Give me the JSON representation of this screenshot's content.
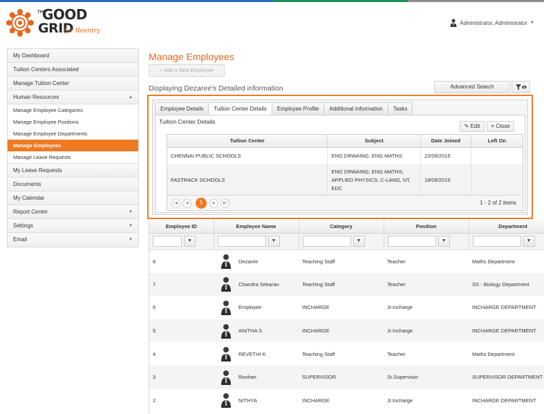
{
  "colors": {
    "accent": "#f07a22",
    "topbar": [
      "#2a6ebb",
      "#1f8f5a",
      "#7a7a7a"
    ]
  },
  "header": {
    "logo": {
      "the": "THE",
      "good": "GOOD",
      "grid": "GRID",
      "tagline": "for Reentry"
    },
    "user": {
      "name": "Administrator, Administrator",
      "icon": "user-avatar-icon"
    }
  },
  "sidebar": {
    "items": [
      {
        "label": "My Dashboard"
      },
      {
        "label": "Tuition Centers Associated"
      },
      {
        "label": "Manage Tuition Center"
      },
      {
        "label": "Human Resources",
        "expanded": true
      }
    ],
    "sub_items": [
      {
        "label": "Manage Employee Categories"
      },
      {
        "label": "Manage Employee Positions"
      },
      {
        "label": "Manage Employee Departments"
      },
      {
        "label": "Manage Employees",
        "active": true
      },
      {
        "label": "Manage Leave Requests"
      }
    ],
    "items_after": [
      {
        "label": "My Leave Requests"
      },
      {
        "label": "Documents"
      },
      {
        "label": "My Calendar"
      },
      {
        "label": "Report Center",
        "arrow": "▼"
      },
      {
        "label": "Settings",
        "arrow": "▼"
      },
      {
        "label": "Email",
        "arrow": "▼"
      }
    ]
  },
  "main": {
    "title": "Manage Employees",
    "add_button": "+ Add a New Employee",
    "subheading": "Displaying Dezaree's Detailed information",
    "advanced_search": "Advanced Search"
  },
  "detail": {
    "tabs": [
      "Employee Details",
      "Tuition Center Details",
      "Employee Profile",
      "Additional Information",
      "Tasks"
    ],
    "active_tab": 1,
    "section_title": "Tuition Center Details",
    "edit_label": "Edit",
    "close_label": "Close",
    "columns": [
      "Tuition Center",
      "Subject",
      "Date Joined",
      "Left On"
    ],
    "rows": [
      {
        "center": "CHENNAI PUBLIC SCHOOLS",
        "subject": "ENG DRWAING, ENG MATHS",
        "joined": "22/09/2015",
        "left": ""
      },
      {
        "center": "FASTRACK SCHOOLS",
        "subject": "ENG DRWAING, ENG MATHS, APPLIED PHYSICS, C-LANG, NT, EDC",
        "joined": "18/09/2015",
        "left": ""
      }
    ],
    "pager": {
      "current_page": "1",
      "info": "1 - 2 of 2 items"
    }
  },
  "grid": {
    "columns": [
      "Employee ID",
      "Employee Name",
      "Category",
      "Position",
      "Department"
    ],
    "rows": [
      {
        "id": "8",
        "name": "Dezaree",
        "category": "Teaching Staff",
        "position": "Teacher",
        "department": "Maths Department"
      },
      {
        "id": "7",
        "name": "Chandra Sekaran",
        "category": "Teaching Staff",
        "position": "Teacher",
        "department": "SS - Biology Department"
      },
      {
        "id": "6",
        "name": "Employee",
        "category": "INCHARGE",
        "position": "Jr.Incharge",
        "department": "INCHARGE DEPARTMENT"
      },
      {
        "id": "5",
        "name": "ANITHA S",
        "category": "INCHARGE",
        "position": "Jr.Incharge",
        "department": "INCHARGE DEPARTMENT"
      },
      {
        "id": "4",
        "name": "REVETHI K",
        "category": "Teaching Staff",
        "position": "Teacher",
        "department": "Maths Department"
      },
      {
        "id": "3",
        "name": "Roshan",
        "category": "SUPERVISOR",
        "position": "Sr.Supervisor",
        "department": "SUPERVISOR DEPARTMENT"
      },
      {
        "id": "2",
        "name": "NITHYA",
        "category": "INCHARGE",
        "position": "Jr.Incharge",
        "department": "INCHARGE DEPARTMENT"
      }
    ]
  }
}
